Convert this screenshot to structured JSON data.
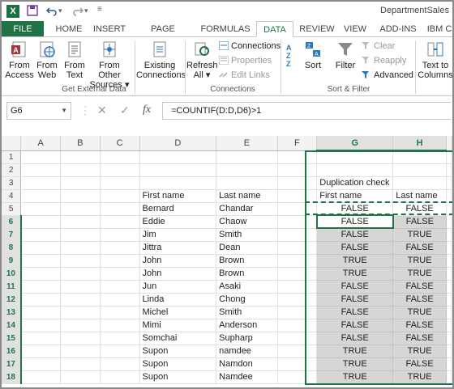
{
  "window": {
    "doc_title": "DepartmentSales"
  },
  "quick_access": [
    "save-icon",
    "undo-icon",
    "redo-icon"
  ],
  "tabs": [
    "FILE",
    "HOME",
    "INSERT",
    "PAGE LAYOUT",
    "FORMULAS",
    "DATA",
    "REVIEW",
    "VIEW",
    "ADD-INS",
    "IBM C"
  ],
  "active_tab": "DATA",
  "ribbon": {
    "get_external": {
      "buttons": [
        "From\nAccess",
        "From\nWeb",
        "From\nText",
        "From Other\nSources"
      ],
      "b1a": "From",
      "b1b": "Access",
      "b2a": "From",
      "b2b": "Web",
      "b3a": "From",
      "b3b": "Text",
      "b4a": "From Other",
      "b4b": "Sources ▾",
      "b5a": "Existing",
      "b5b": "Connections",
      "label": "Get External Data"
    },
    "connections": {
      "refresh_a": "Refresh",
      "refresh_b": "All ▾",
      "connections": "Connections",
      "properties": "Properties",
      "edit_links": "Edit Links",
      "label": "Connections"
    },
    "sort_filter": {
      "sort": "Sort",
      "filter": "Filter",
      "clear": "Clear",
      "reapply": "Reapply",
      "advanced": "Advanced",
      "label": "Sort & Filter"
    },
    "data_tools": {
      "text_to_a": "Text to",
      "text_to_b": "Columns"
    }
  },
  "formula_bar": {
    "name_box": "G6",
    "formula": "=COUNTIF(D:D,D6)>1"
  },
  "columns": [
    "A",
    "B",
    "C",
    "D",
    "E",
    "F",
    "G",
    "H"
  ],
  "selected_columns": [
    "G",
    "H"
  ],
  "rows": [
    {
      "n": "1",
      "D": "",
      "E": "",
      "G": "",
      "H": ""
    },
    {
      "n": "2",
      "D": "",
      "E": "",
      "G": "",
      "H": ""
    },
    {
      "n": "3",
      "D": "",
      "E": "",
      "G": "Duplication check",
      "H": ""
    },
    {
      "n": "4",
      "D": "First name",
      "E": "Last name",
      "G": "First name",
      "H": "Last name"
    },
    {
      "n": "5",
      "D": "Bernard",
      "E": "Chandar",
      "G": "FALSE",
      "H": "FALSE"
    },
    {
      "n": "6",
      "D": "Eddie",
      "E": "Chaow",
      "G": "FALSE",
      "H": "FALSE"
    },
    {
      "n": "7",
      "D": "Jim",
      "E": "Smith",
      "G": "FALSE",
      "H": "TRUE"
    },
    {
      "n": "8",
      "D": "Jittra",
      "E": "Dean",
      "G": "FALSE",
      "H": "FALSE"
    },
    {
      "n": "9",
      "D": "John",
      "E": "Brown",
      "G": "TRUE",
      "H": "TRUE"
    },
    {
      "n": "10",
      "D": "John",
      "E": "Brown",
      "G": "TRUE",
      "H": "TRUE"
    },
    {
      "n": "11",
      "D": "Jun",
      "E": "Asaki",
      "G": "FALSE",
      "H": "FALSE"
    },
    {
      "n": "12",
      "D": "Linda",
      "E": "Chong",
      "G": "FALSE",
      "H": "FALSE"
    },
    {
      "n": "13",
      "D": "Michel",
      "E": "Smith",
      "G": "FALSE",
      "H": "TRUE"
    },
    {
      "n": "14",
      "D": "Mimi",
      "E": "Anderson",
      "G": "FALSE",
      "H": "FALSE"
    },
    {
      "n": "15",
      "D": "Somchai",
      "E": "Supharp",
      "G": "FALSE",
      "H": "FALSE"
    },
    {
      "n": "16",
      "D": "Supon",
      "E": "namdee",
      "G": "TRUE",
      "H": "TRUE"
    },
    {
      "n": "17",
      "D": "Supon",
      "E": "Namdon",
      "G": "TRUE",
      "H": "FALSE"
    },
    {
      "n": "18",
      "D": "Supon",
      "E": "Namdee",
      "G": "TRUE",
      "H": "TRUE"
    }
  ],
  "colors": {
    "accent": "#217346",
    "selection_fill": "#d6d6d6"
  }
}
